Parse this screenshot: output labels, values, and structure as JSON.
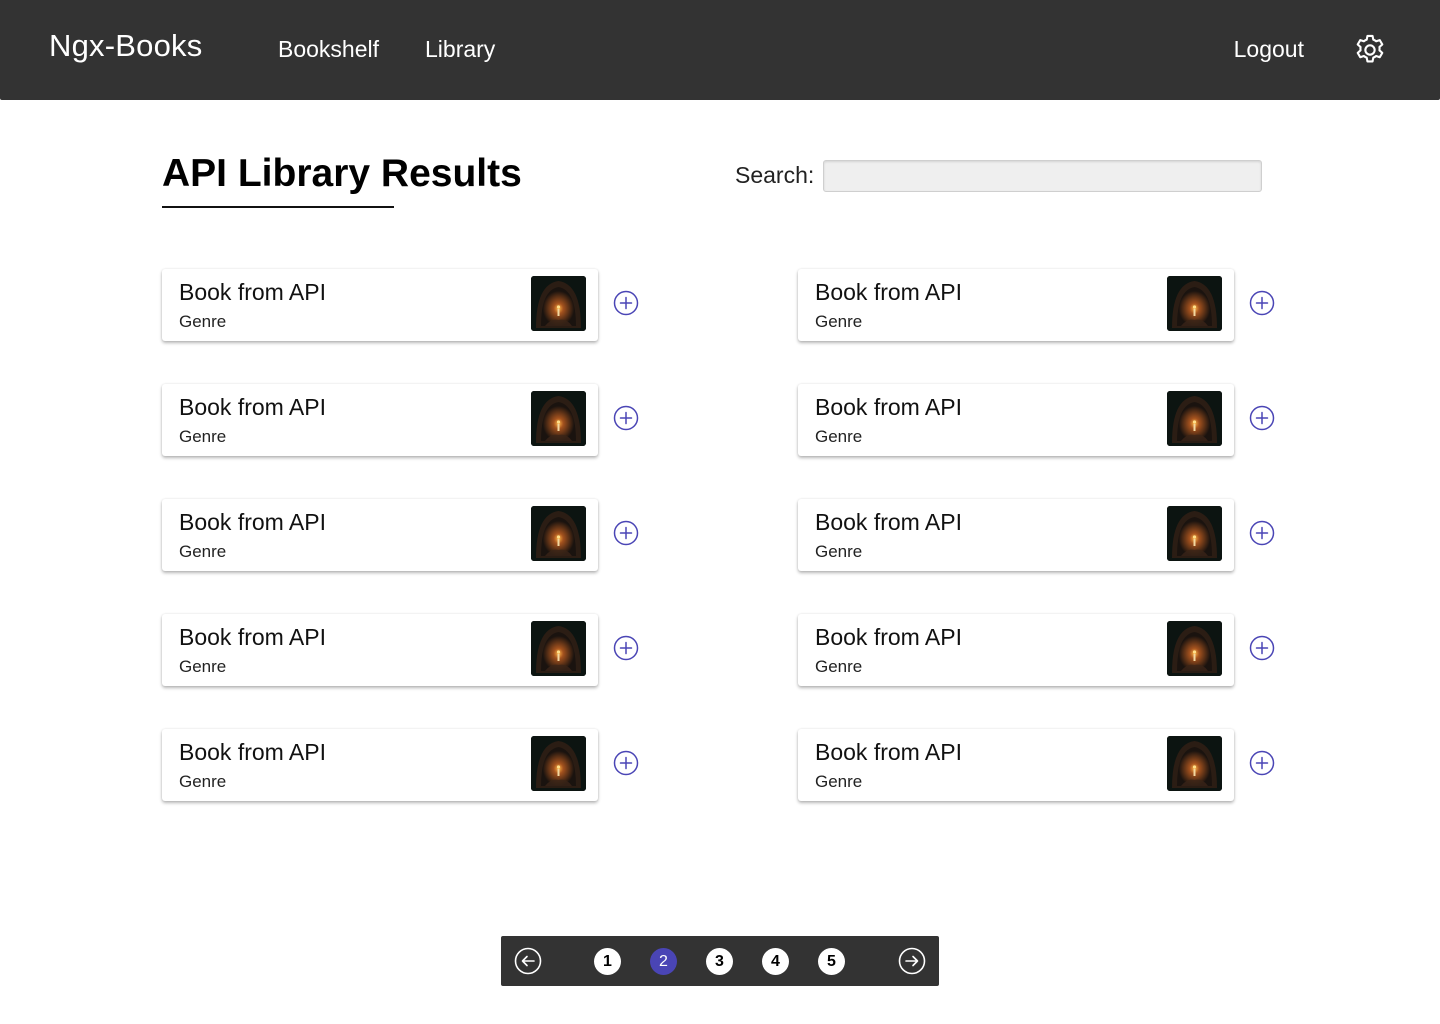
{
  "header": {
    "brand": "Ngx-Books",
    "nav": [
      "Bookshelf",
      "Library"
    ],
    "logout": "Logout",
    "settings_icon": "gear-icon"
  },
  "main": {
    "title": "API Library Results",
    "search_label": "Search:",
    "search_value": "",
    "search_placeholder": ""
  },
  "books": [
    {
      "title": "Book from API",
      "genre": "Genre"
    },
    {
      "title": "Book from API",
      "genre": "Genre"
    },
    {
      "title": "Book from API",
      "genre": "Genre"
    },
    {
      "title": "Book from API",
      "genre": "Genre"
    },
    {
      "title": "Book from API",
      "genre": "Genre"
    },
    {
      "title": "Book from API",
      "genre": "Genre"
    },
    {
      "title": "Book from API",
      "genre": "Genre"
    },
    {
      "title": "Book from API",
      "genre": "Genre"
    },
    {
      "title": "Book from API",
      "genre": "Genre"
    },
    {
      "title": "Book from API",
      "genre": "Genre"
    }
  ],
  "pagination": {
    "pages": [
      "1",
      "2",
      "3",
      "4",
      "5"
    ],
    "current": "2",
    "prev_icon": "arrow-left-circle-icon",
    "next_icon": "arrow-right-circle-icon"
  },
  "colors": {
    "header_bg": "#333333",
    "accent": "#4a45b5",
    "add_icon": "#4a45b5"
  }
}
